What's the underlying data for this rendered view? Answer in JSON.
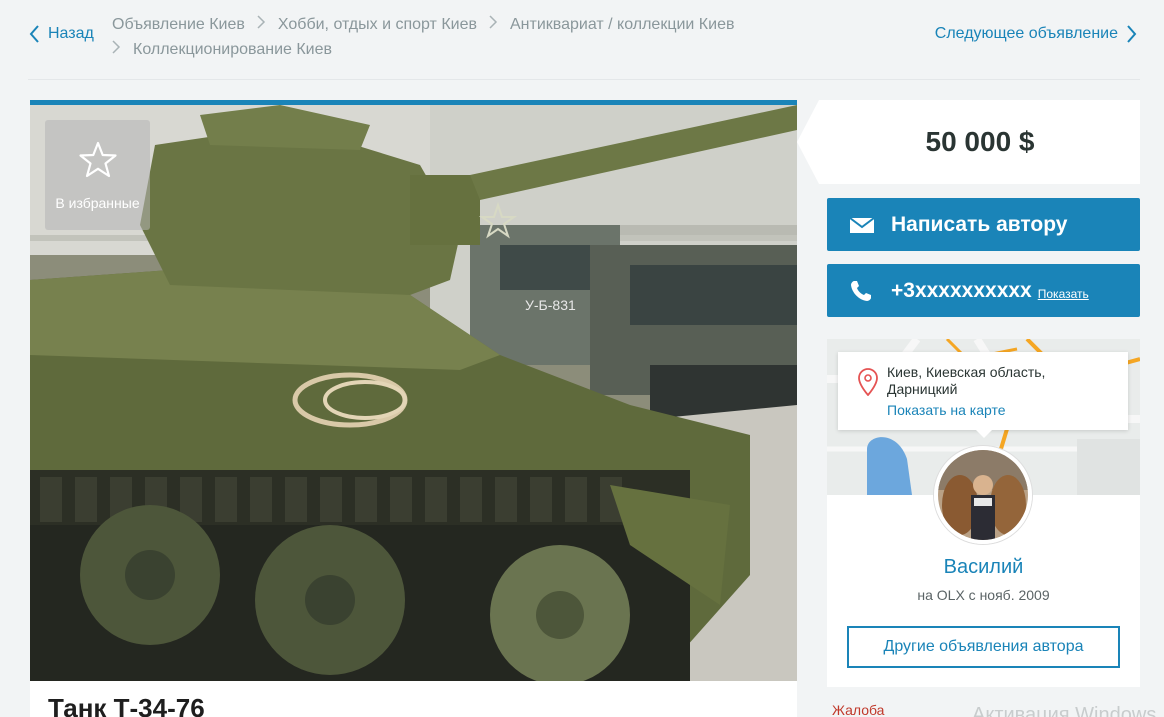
{
  "nav": {
    "back_label": "Назад",
    "next_label": "Следующее объявление",
    "breadcrumbs": [
      "Объявление Киев",
      "Хобби, отдых и спорт Киев",
      "Антиквариат / коллекции Киев",
      "Коллекционирование Киев"
    ]
  },
  "gallery": {
    "favorite_label": "В избранные",
    "plate_text": "У-Б-831"
  },
  "ad": {
    "title": "Танк Т-34-76",
    "price": "50 000 $"
  },
  "actions": {
    "write_label": "Написать автору",
    "phone": "+3xxxxxxxxxx",
    "show_label": "Показать"
  },
  "seller": {
    "address": "Киев, Киевская область, Дарницкий",
    "map_link": "Показать на карте",
    "name": "Василий",
    "since": "на OLX с нояб. 2009",
    "other_ads_label": "Другие объявления автора"
  },
  "footer": {
    "complaint_label": "Жалоба",
    "watermark": "Активация Windows"
  },
  "colors": {
    "accent": "#1a84b8",
    "background": "#f2f4f5",
    "complaint": "#c0392b"
  },
  "icons": [
    "chevron-left-icon",
    "chevron-right-icon",
    "star-icon",
    "envelope-icon",
    "phone-icon",
    "map-pin-icon"
  ]
}
